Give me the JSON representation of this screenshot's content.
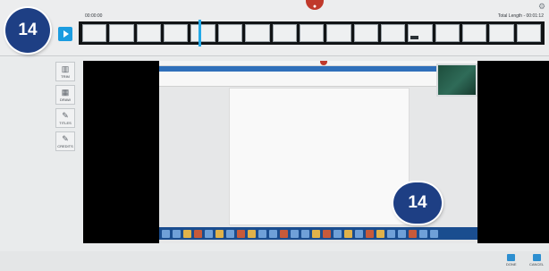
{
  "badges": {
    "top": "14",
    "preview": "14"
  },
  "timeline": {
    "start_time": "00:00:00",
    "total_length": "Total Length - 00:01:12",
    "frame_count": 17
  },
  "tools": [
    {
      "label": "TRIM",
      "icon": "trim-icon",
      "glyph": "▥"
    },
    {
      "label": "DRAW",
      "icon": "draw-icon",
      "glyph": "▦"
    },
    {
      "label": "TITLES",
      "icon": "titles-icon",
      "glyph": "✎"
    },
    {
      "label": "CREDITS",
      "icon": "credits-icon",
      "glyph": "✎"
    }
  ],
  "actions": {
    "done": "DONE",
    "cancel": "CANCEL"
  },
  "colors": {
    "badge": "#1e3f84",
    "accent": "#1b9ce0",
    "record": "#c0392b"
  }
}
